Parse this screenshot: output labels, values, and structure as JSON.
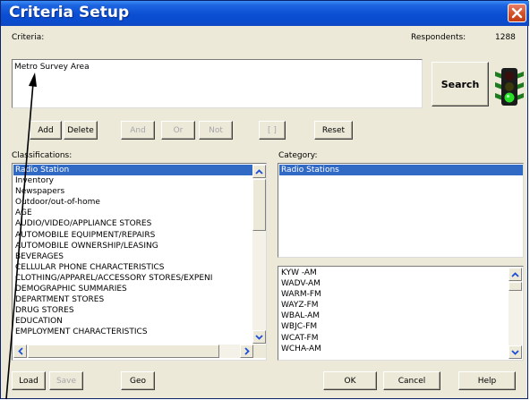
{
  "window": {
    "title": "Criteria Setup"
  },
  "criteria": {
    "label": "Criteria:",
    "value": "Metro Survey Area"
  },
  "respondents": {
    "label": "Respondents:",
    "count": "1288"
  },
  "buttons": {
    "search": "Search",
    "add": "Add",
    "delete": "Delete",
    "and": "And",
    "or": "Or",
    "not": "Not",
    "parens": "[ ]",
    "reset": "Reset",
    "load": "Load",
    "save": "Save",
    "geo": "Geo",
    "ok": "OK",
    "cancel": "Cancel",
    "help": "Help"
  },
  "classifications": {
    "label": "Classifications:",
    "selected": "Radio Station",
    "items": [
      "Radio Station",
      "Inventory",
      "Newspapers",
      "Outdoor/out-of-home",
      "AGE",
      "AUDIO/VIDEO/APPLIANCE STORES",
      "AUTOMOBILE EQUIPMENT/REPAIRS",
      "AUTOMOBILE OWNERSHIP/LEASING",
      "BEVERAGES",
      "CELLULAR PHONE CHARACTERISTICS",
      "CLOTHING/APPAREL/ACCESSORY STORES/EXPENI",
      "DEMOGRAPHIC SUMMARIES",
      "DEPARTMENT STORES",
      "DRUG STORES",
      "EDUCATION",
      "EMPLOYMENT CHARACTERISTICS"
    ]
  },
  "category": {
    "label": "Category:",
    "items": [
      "Radio Stations"
    ],
    "selected": "Radio Stations"
  },
  "stations": {
    "items": [
      "KYW -AM",
      "WADV-AM",
      "WARM-FM",
      "WAYZ-FM",
      "WBAL-AM",
      "WBJC-FM",
      "WCAT-FM",
      "WCHA-AM"
    ]
  },
  "colors": {
    "title_bar": "#0b4ed3",
    "selection": "#316ac5",
    "dialog_bg": "#ece9d8",
    "close_button": "#d4542c"
  },
  "icons": {
    "traffic_light": "traffic-light-icon",
    "close": "close-icon"
  }
}
